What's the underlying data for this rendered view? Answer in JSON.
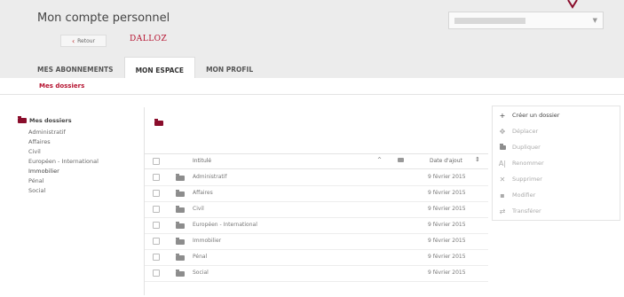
{
  "header": {
    "title": "Mon compte personnel",
    "back_label": "Retour",
    "logo_text": "DALLOZ"
  },
  "tabs": [
    {
      "label": "MES ABONNEMENTS"
    },
    {
      "label": "MON ESPACE"
    },
    {
      "label": "MON PROFIL"
    }
  ],
  "subnav": {
    "label": "Mes dossiers"
  },
  "tree": {
    "root": "Mes dossiers",
    "items": [
      "Administratif",
      "Affaires",
      "Civil",
      "Européen - International",
      "Immobilier",
      "Pénal",
      "Social"
    ]
  },
  "table": {
    "col_title": "Intitulé",
    "col_date": "Date d'ajout",
    "rows": [
      {
        "name": "Administratif",
        "date": "9 février 2015"
      },
      {
        "name": "Affaires",
        "date": "9 février 2015"
      },
      {
        "name": "Civil",
        "date": "9 février 2015"
      },
      {
        "name": "Européen - International",
        "date": "9 février 2015"
      },
      {
        "name": "Immobilier",
        "date": "9 février 2015"
      },
      {
        "name": "Pénal",
        "date": "9 février 2015"
      },
      {
        "name": "Social",
        "date": "9 février 2015"
      }
    ]
  },
  "actions": [
    {
      "label": "Créer un dossier",
      "icon": "plus-icon",
      "enabled": true
    },
    {
      "label": "Déplacer",
      "icon": "move-icon",
      "enabled": false
    },
    {
      "label": "Dupliquer",
      "icon": "folder-icon",
      "enabled": false
    },
    {
      "label": "Renommer",
      "icon": "rename-icon",
      "enabled": false
    },
    {
      "label": "Supprimer",
      "icon": "close-icon",
      "enabled": false
    },
    {
      "label": "Modifier",
      "icon": "comment-icon",
      "enabled": false
    },
    {
      "label": "Transférer",
      "icon": "transfer-icon",
      "enabled": false
    }
  ],
  "colors": {
    "accent": "#b5122f",
    "folder_dark": "#8a0d2b",
    "header_bg": "#ececec"
  }
}
